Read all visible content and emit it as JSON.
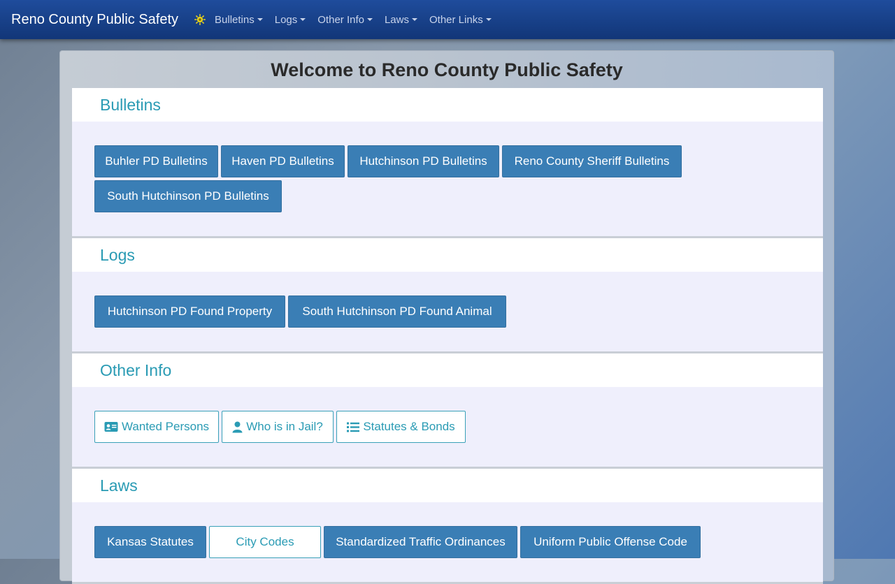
{
  "navbar": {
    "brand": "Reno County Public Safety",
    "logo_icon": "sun-badge-icon",
    "items": [
      {
        "label": "Bulletins"
      },
      {
        "label": "Logs"
      },
      {
        "label": "Other Info"
      },
      {
        "label": "Laws"
      },
      {
        "label": "Other Links"
      }
    ]
  },
  "page": {
    "title": "Welcome to Reno County Public Safety"
  },
  "sections": {
    "bulletins": {
      "title": "Bulletins",
      "buttons": [
        "Buhler PD Bulletins",
        "Haven PD Bulletins",
        "Hutchinson PD Bulletins",
        "Reno County Sheriff Bulletins",
        "South Hutchinson PD Bulletins"
      ]
    },
    "logs": {
      "title": "Logs",
      "buttons": [
        "Hutchinson PD Found Property",
        "South Hutchinson PD Found Animal"
      ]
    },
    "other_info": {
      "title": "Other Info",
      "buttons": [
        {
          "label": "Wanted Persons",
          "icon": "id-card-icon"
        },
        {
          "label": "Who is in Jail?",
          "icon": "user-icon"
        },
        {
          "label": "Statutes & Bonds",
          "icon": "list-icon"
        }
      ]
    },
    "laws": {
      "title": "Laws",
      "buttons": [
        "Kansas Statutes",
        "City Codes",
        "Standardized Traffic Ordinances",
        "Uniform Public Offense Code"
      ]
    }
  },
  "colors": {
    "navbar": "#173f86",
    "accent": "#2a9bb4",
    "button": "#3a7eb5",
    "card_body": "#efeffc"
  }
}
